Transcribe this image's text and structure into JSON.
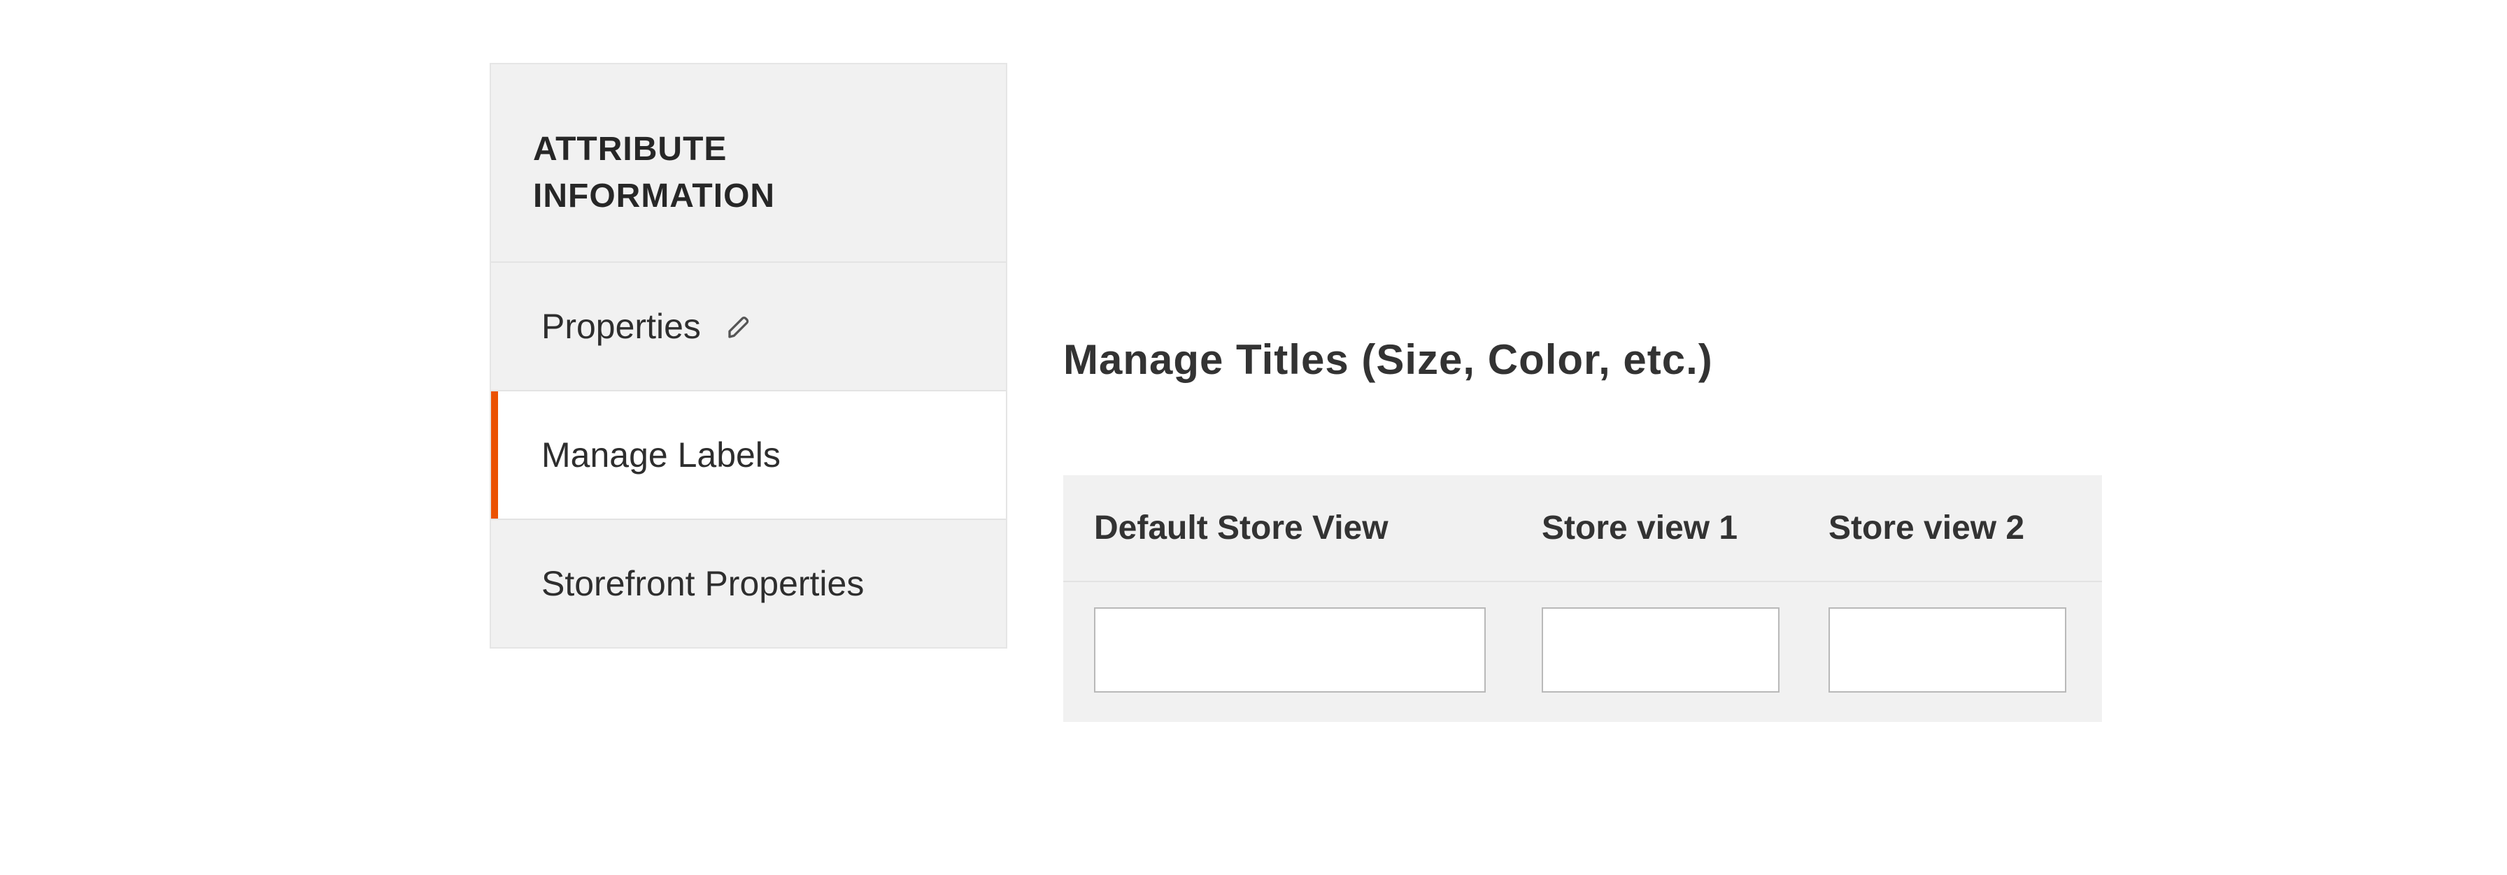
{
  "sidebar": {
    "title": "ATTRIBUTE INFORMATION",
    "items": [
      {
        "label": "Properties",
        "has_edit_icon": true,
        "active": false
      },
      {
        "label": "Manage Labels",
        "has_edit_icon": false,
        "active": true
      },
      {
        "label": "Storefront Properties",
        "has_edit_icon": false,
        "active": false
      }
    ]
  },
  "main": {
    "title": "Manage Titles (Size, Color, etc.)",
    "columns": [
      "Default Store View",
      "Store view 1",
      "Store view 2"
    ],
    "row_values": [
      "",
      "",
      ""
    ]
  },
  "icons": {
    "pencil": "pencil-icon"
  }
}
